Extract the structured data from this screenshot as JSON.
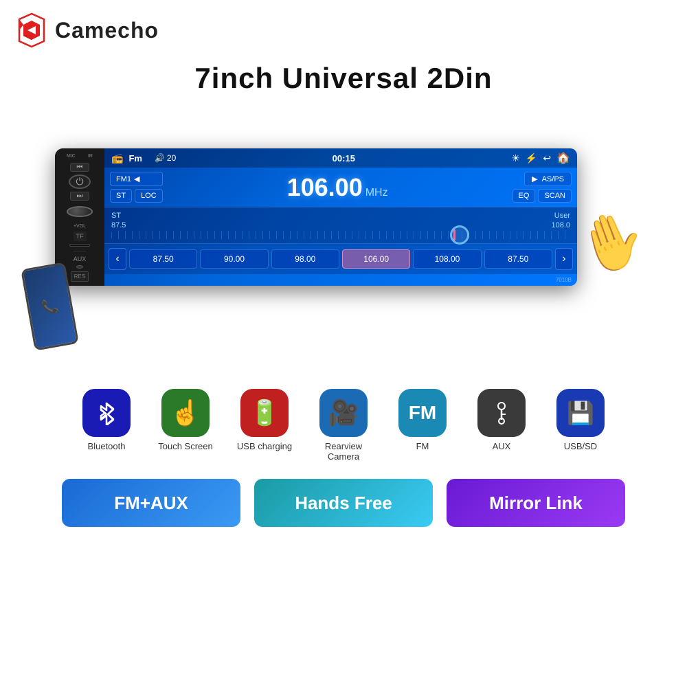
{
  "brand": {
    "name": "Camecho"
  },
  "product": {
    "title": "7inch Universal 2Din",
    "model": "7010B"
  },
  "screen": {
    "topbar": {
      "fm_text": "Fm",
      "volume": "20",
      "time": "00:15"
    },
    "fm_station": "FM1",
    "freq_main": "106.00",
    "freq_unit": "MHz",
    "freq_start": "87.5",
    "freq_end": "108.0",
    "st_label": "ST",
    "user_label": "User",
    "buttons": {
      "st": "ST",
      "loc": "LOC",
      "asps": "AS/PS",
      "eq": "EQ",
      "scan": "SCAN"
    },
    "presets": [
      "87.50",
      "90.00",
      "98.00",
      "106.00",
      "108.00",
      "87.50"
    ]
  },
  "features": [
    {
      "label": "Bluetooth",
      "icon": "bluetooth",
      "bg": "#1a1ab4"
    },
    {
      "label": "Touch Screen",
      "icon": "touch",
      "bg": "#2a7a2a"
    },
    {
      "label": "USB charging",
      "icon": "usb-charge",
      "bg": "#c02020"
    },
    {
      "label": "Rearview Camera",
      "icon": "camera",
      "bg": "#1a6ab4"
    },
    {
      "label": "FM",
      "icon": "fm",
      "bg": "#1a8ab4"
    },
    {
      "label": "AUX",
      "icon": "aux",
      "bg": "#3a3a3a"
    },
    {
      "label": "USB/SD",
      "icon": "usb-sd",
      "bg": "#1a3ab4"
    }
  ],
  "badges": [
    {
      "text": "FM+AUX",
      "style": "blue"
    },
    {
      "text": "Hands Free",
      "style": "teal"
    },
    {
      "text": "Mirror Link",
      "style": "purple"
    }
  ]
}
